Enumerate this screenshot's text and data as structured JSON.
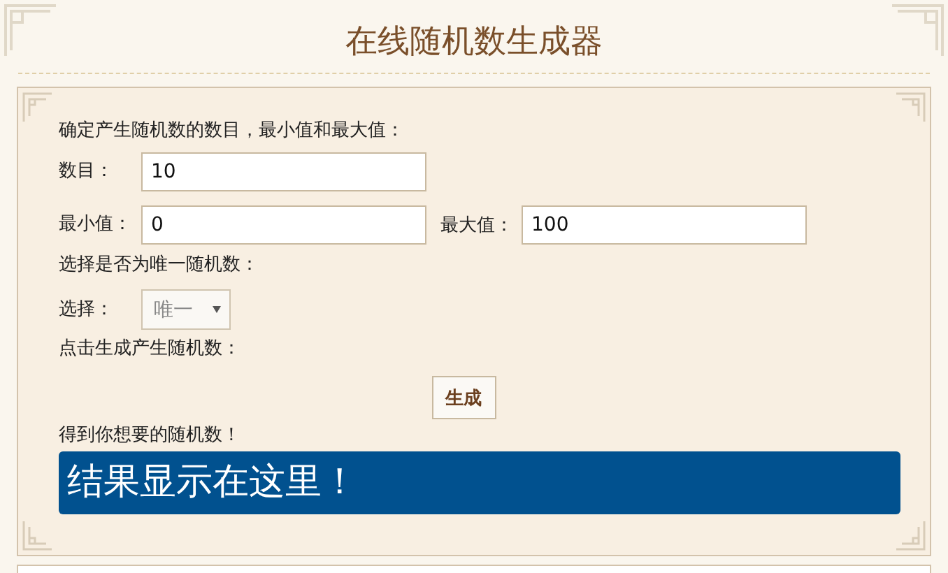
{
  "title": "在线随机数生成器",
  "form": {
    "intro": "确定产生随机数的数目，最小值和最大值：",
    "count": {
      "label": "数目：",
      "value": "10"
    },
    "min": {
      "label": "最小值：",
      "value": "0"
    },
    "max": {
      "label": "最大值：",
      "value": "100"
    },
    "unique_prompt": "选择是否为唯一随机数：",
    "choice": {
      "label": "选择：",
      "value": "唯一",
      "disabled": true
    },
    "generate_prompt": "点击生成产生随机数：",
    "generate_button": "生成",
    "result_label": "得到你想要的随机数！",
    "result": "结果显示在这里！"
  }
}
